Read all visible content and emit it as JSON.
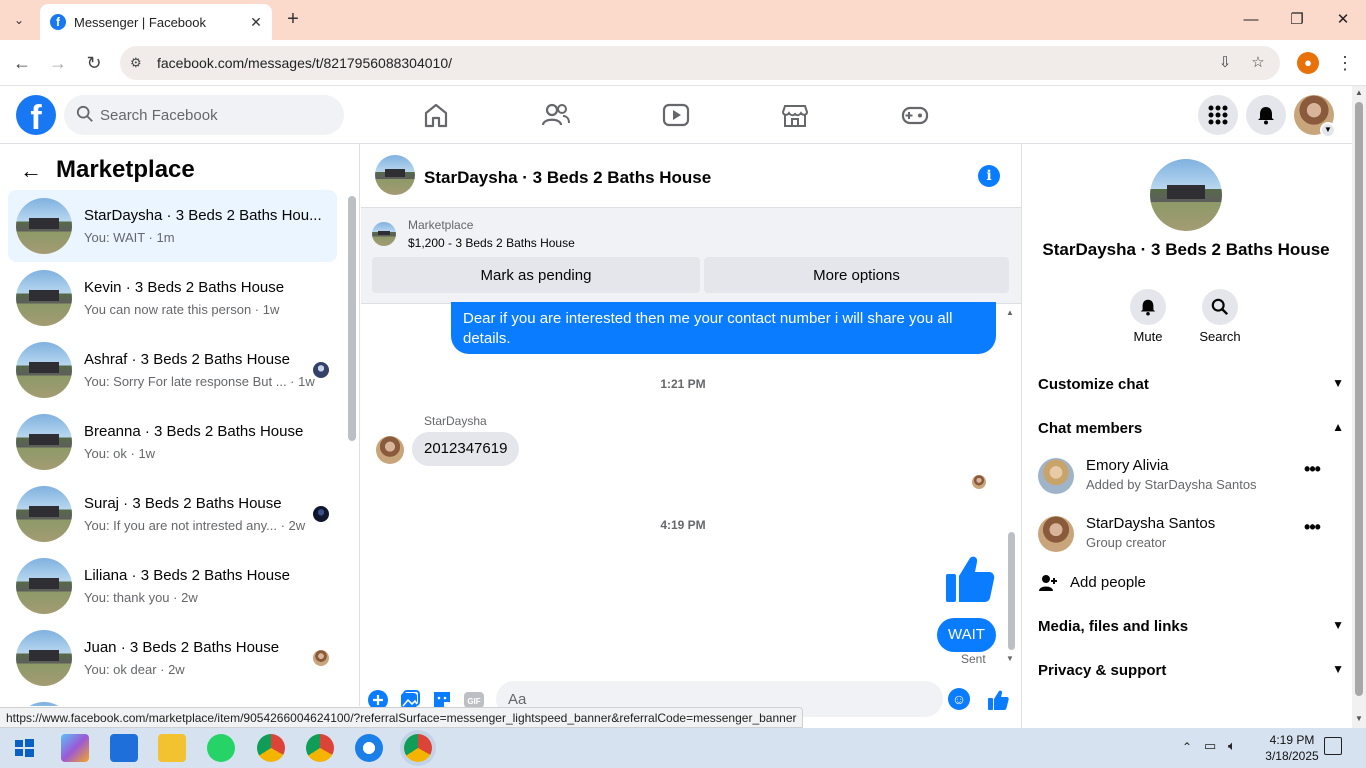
{
  "browser": {
    "tab_title": "Messenger | Facebook",
    "url": "facebook.com/messages/t/8217956088304010/",
    "status_url": "https://www.facebook.com/marketplace/item/905426600462410​0/?referralSurface=messenger_lightspeed_banner&referralCode=messenger_banner"
  },
  "fb": {
    "search_placeholder": "Search Facebook",
    "brand_color": "#1877f2"
  },
  "left": {
    "title": "Marketplace",
    "conversations": [
      {
        "name": "StarDaysha · 3 Beds 2 Baths Hou...",
        "sub": "You: WAIT · 1m",
        "selected": true
      },
      {
        "name": "Kevin · 3 Beds 2 Baths House",
        "sub": "You can now rate this person · 1w"
      },
      {
        "name": "Ashraf · 3 Beds 2 Baths House",
        "sub": "You: Sorry For late response But ... · 1w"
      },
      {
        "name": "Breanna · 3 Beds 2 Baths House",
        "sub": "You: ok · 1w"
      },
      {
        "name": "Suraj · 3 Beds 2 Baths House",
        "sub": "You: If you are not intrested any... · 2w"
      },
      {
        "name": "Liliana · 3 Beds 2 Baths House",
        "sub": "You: thank you · 2w"
      },
      {
        "name": "Juan · 3 Beds 2 Baths House",
        "sub": "You: ok dear · 2w"
      }
    ]
  },
  "chat": {
    "title": "StarDaysha · 3 Beds 2 Baths House",
    "banner": {
      "label": "Marketplace",
      "listing": "$1,200 - 3 Beds 2 Baths House",
      "btn_pending": "Mark as pending",
      "btn_more": "More options"
    },
    "messages": {
      "outgoing_1": "Dear if you are interested then me your contact number i will share you all details.",
      "time_1": "1:21 PM",
      "sender": "StarDaysha",
      "incoming_1": "2012347619",
      "time_2": "4:19 PM",
      "outgoing_2": "WAIT",
      "status": "Sent"
    },
    "composer_placeholder": "Aa"
  },
  "right": {
    "title": "StarDaysha · 3 Beds 2 Baths House",
    "mute_label": "Mute",
    "search_label": "Search",
    "customize_chat": "Customize chat",
    "chat_members": "Chat members",
    "members": [
      {
        "name": "Emory Alivia",
        "desc": "Added by StarDaysha Santos"
      },
      {
        "name": "StarDaysha Santos",
        "desc": "Group creator"
      }
    ],
    "add_people": "Add people",
    "media": "Media, files and links",
    "privacy": "Privacy & support"
  },
  "taskbar": {
    "time": "4:19 PM",
    "date": "3/18/2025"
  }
}
